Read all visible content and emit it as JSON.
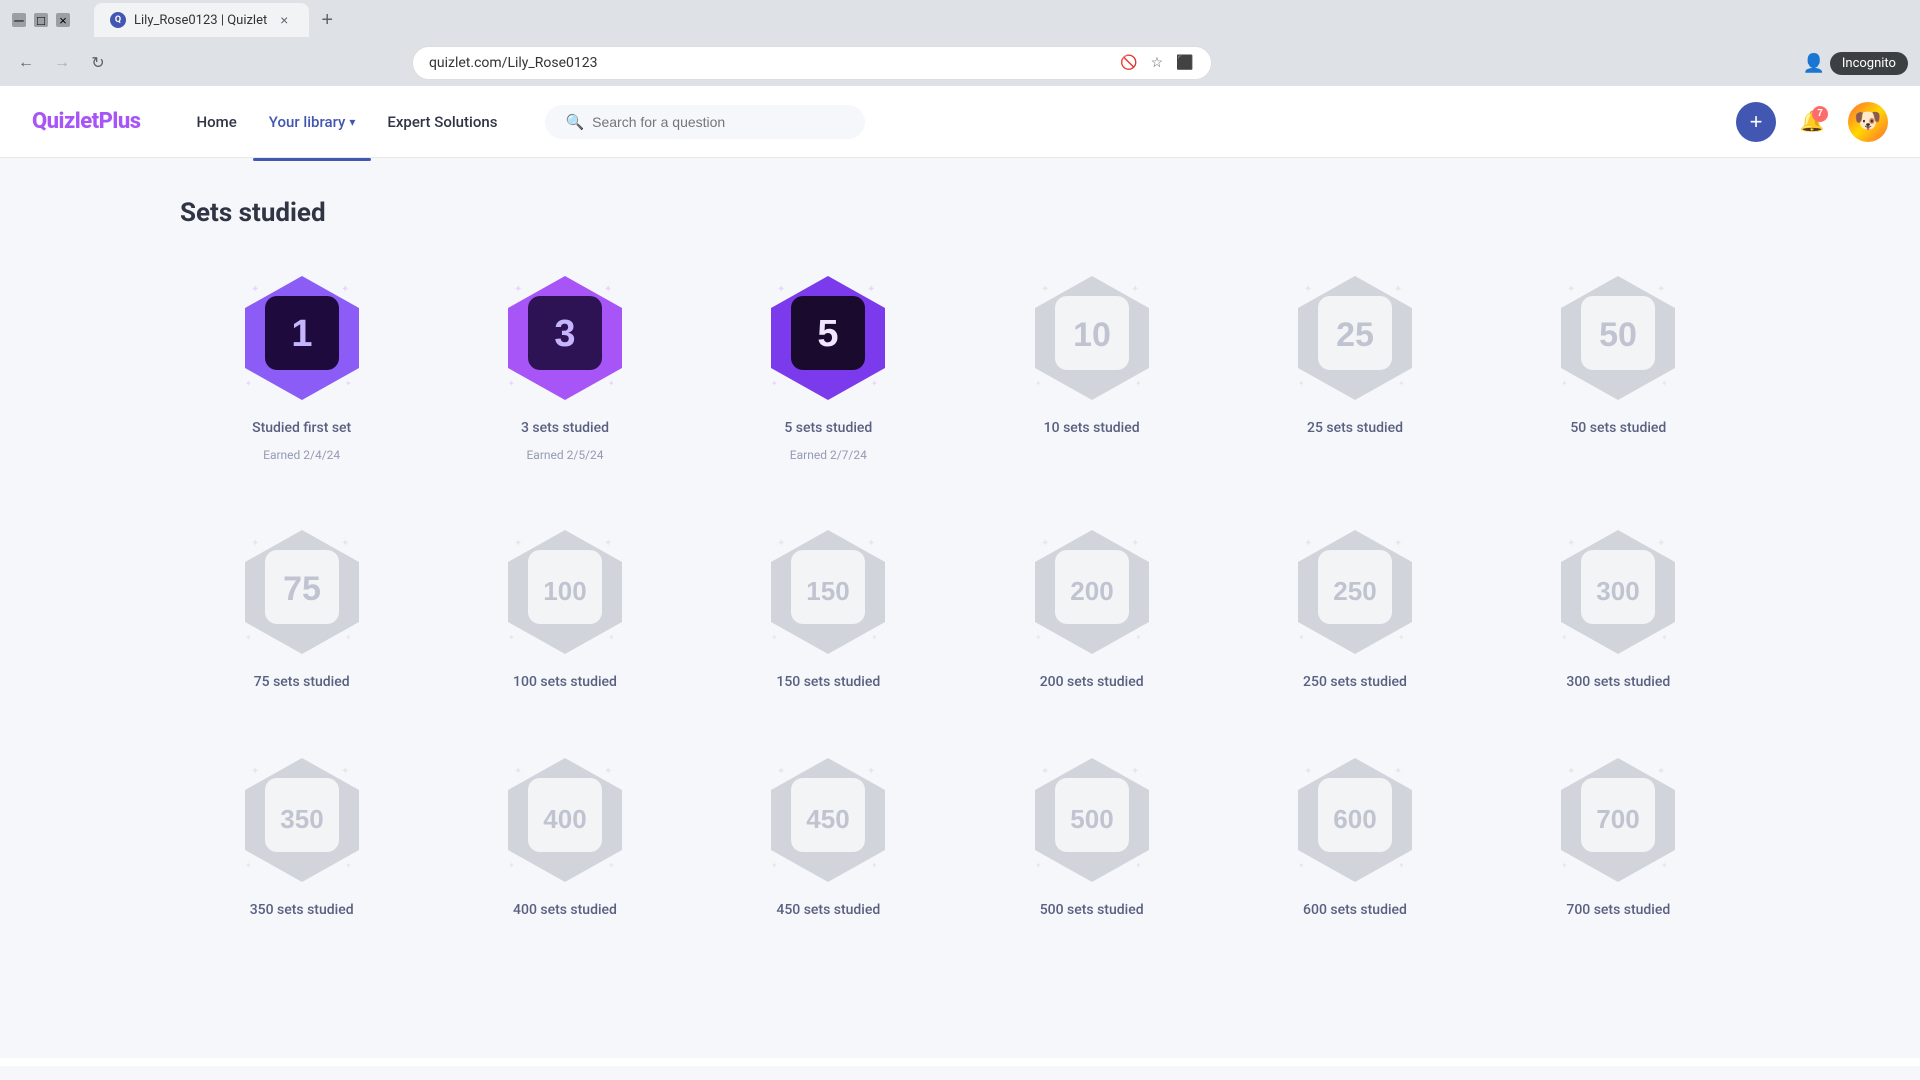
{
  "browser": {
    "tab_title": "Lily_Rose0123 | Quizlet",
    "address": "quizlet.com/Lily_Rose0123",
    "new_tab_symbol": "+",
    "close_symbol": "×",
    "incognito_label": "Incognito"
  },
  "header": {
    "logo_text": "Quizlet",
    "logo_plus": "Plus",
    "nav": {
      "home": "Home",
      "your_library": "Your library",
      "expert_solutions": "Expert Solutions"
    },
    "search_placeholder": "Search for a question",
    "notifications_count": "7"
  },
  "main": {
    "section_title": "Sets studied",
    "badges_row1": [
      {
        "number": "1",
        "label": "Studied first set",
        "earned": "Earned 2/4/24",
        "is_earned": true,
        "tier": 1
      },
      {
        "number": "3",
        "label": "3 sets studied",
        "earned": "Earned 2/5/24",
        "is_earned": true,
        "tier": 2
      },
      {
        "number": "5",
        "label": "5 sets studied",
        "earned": "Earned 2/7/24",
        "is_earned": true,
        "tier": 3
      },
      {
        "number": "10",
        "label": "10 sets studied",
        "earned": "",
        "is_earned": false,
        "tier": 0
      },
      {
        "number": "25",
        "label": "25 sets studied",
        "earned": "",
        "is_earned": false,
        "tier": 0
      },
      {
        "number": "50",
        "label": "50 sets studied",
        "earned": "",
        "is_earned": false,
        "tier": 0
      }
    ],
    "badges_row2": [
      {
        "number": "75",
        "label": "75 sets studied",
        "earned": "",
        "is_earned": false,
        "tier": 0
      },
      {
        "number": "100",
        "label": "100 sets studied",
        "earned": "",
        "is_earned": false,
        "tier": 0
      },
      {
        "number": "150",
        "label": "150 sets studied",
        "earned": "",
        "is_earned": false,
        "tier": 0
      },
      {
        "number": "200",
        "label": "200 sets studied",
        "earned": "",
        "is_earned": false,
        "tier": 0
      },
      {
        "number": "250",
        "label": "250 sets studied",
        "earned": "",
        "is_earned": false,
        "tier": 0
      },
      {
        "number": "300",
        "label": "300 sets studied",
        "earned": "",
        "is_earned": false,
        "tier": 0
      }
    ],
    "badges_row3": [
      {
        "number": "350",
        "label": "350 sets studied",
        "earned": "",
        "is_earned": false,
        "tier": 0
      },
      {
        "number": "400",
        "label": "400 sets studied",
        "earned": "",
        "is_earned": false,
        "tier": 0
      },
      {
        "number": "450",
        "label": "450 sets studied",
        "earned": "",
        "is_earned": false,
        "tier": 0
      },
      {
        "number": "500",
        "label": "500 sets studied",
        "earned": "",
        "is_earned": false,
        "tier": 0
      },
      {
        "number": "600",
        "label": "600 sets studied",
        "earned": "",
        "is_earned": false,
        "tier": 0
      },
      {
        "number": "700",
        "label": "700 sets studied",
        "earned": "",
        "is_earned": false,
        "tier": 0
      }
    ]
  },
  "colors": {
    "earned_1_bg_outer": "#8b5cf6",
    "earned_1_bg_inner": "#7c3aed",
    "earned_2_bg_outer": "#a855f7",
    "earned_2_bg_inner": "#7c3aed",
    "earned_3_bg_outer": "#9333ea",
    "earned_3_bg_inner": "#6d28d9",
    "unearned_bg": "#e5e7eb",
    "unearned_inner": "#f3f4f6"
  }
}
